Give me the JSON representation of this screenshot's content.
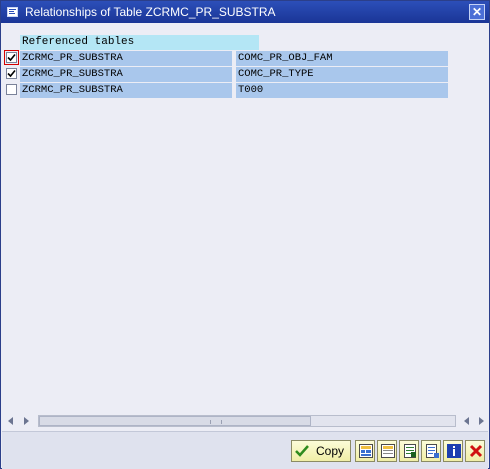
{
  "window": {
    "title": "Relationships of Table ZCRMC_PR_SUBSTRA"
  },
  "table": {
    "header": "Referenced tables",
    "rows": [
      {
        "checked": true,
        "focused": true,
        "table": "ZCRMC_PR_SUBSTRA",
        "referenced": "COMC_PR_OBJ_FAM"
      },
      {
        "checked": true,
        "focused": false,
        "table": "ZCRMC_PR_SUBSTRA",
        "referenced": "COMC_PR_TYPE"
      },
      {
        "checked": false,
        "focused": false,
        "table": "ZCRMC_PR_SUBSTRA",
        "referenced": "T000"
      }
    ]
  },
  "footer": {
    "copy_label": "Copy"
  },
  "colors": {
    "titlebar": "#1f3fa6",
    "header_cell": "#b4e6f5",
    "row_cell": "#a9c7ec",
    "window_bg": "#ecedf5"
  },
  "icons": [
    "title-window-icon",
    "close-icon",
    "checkmark-icon",
    "select-all-icon",
    "deselect-all-icon",
    "details-icon",
    "print-icon",
    "info-icon",
    "cancel-icon"
  ]
}
